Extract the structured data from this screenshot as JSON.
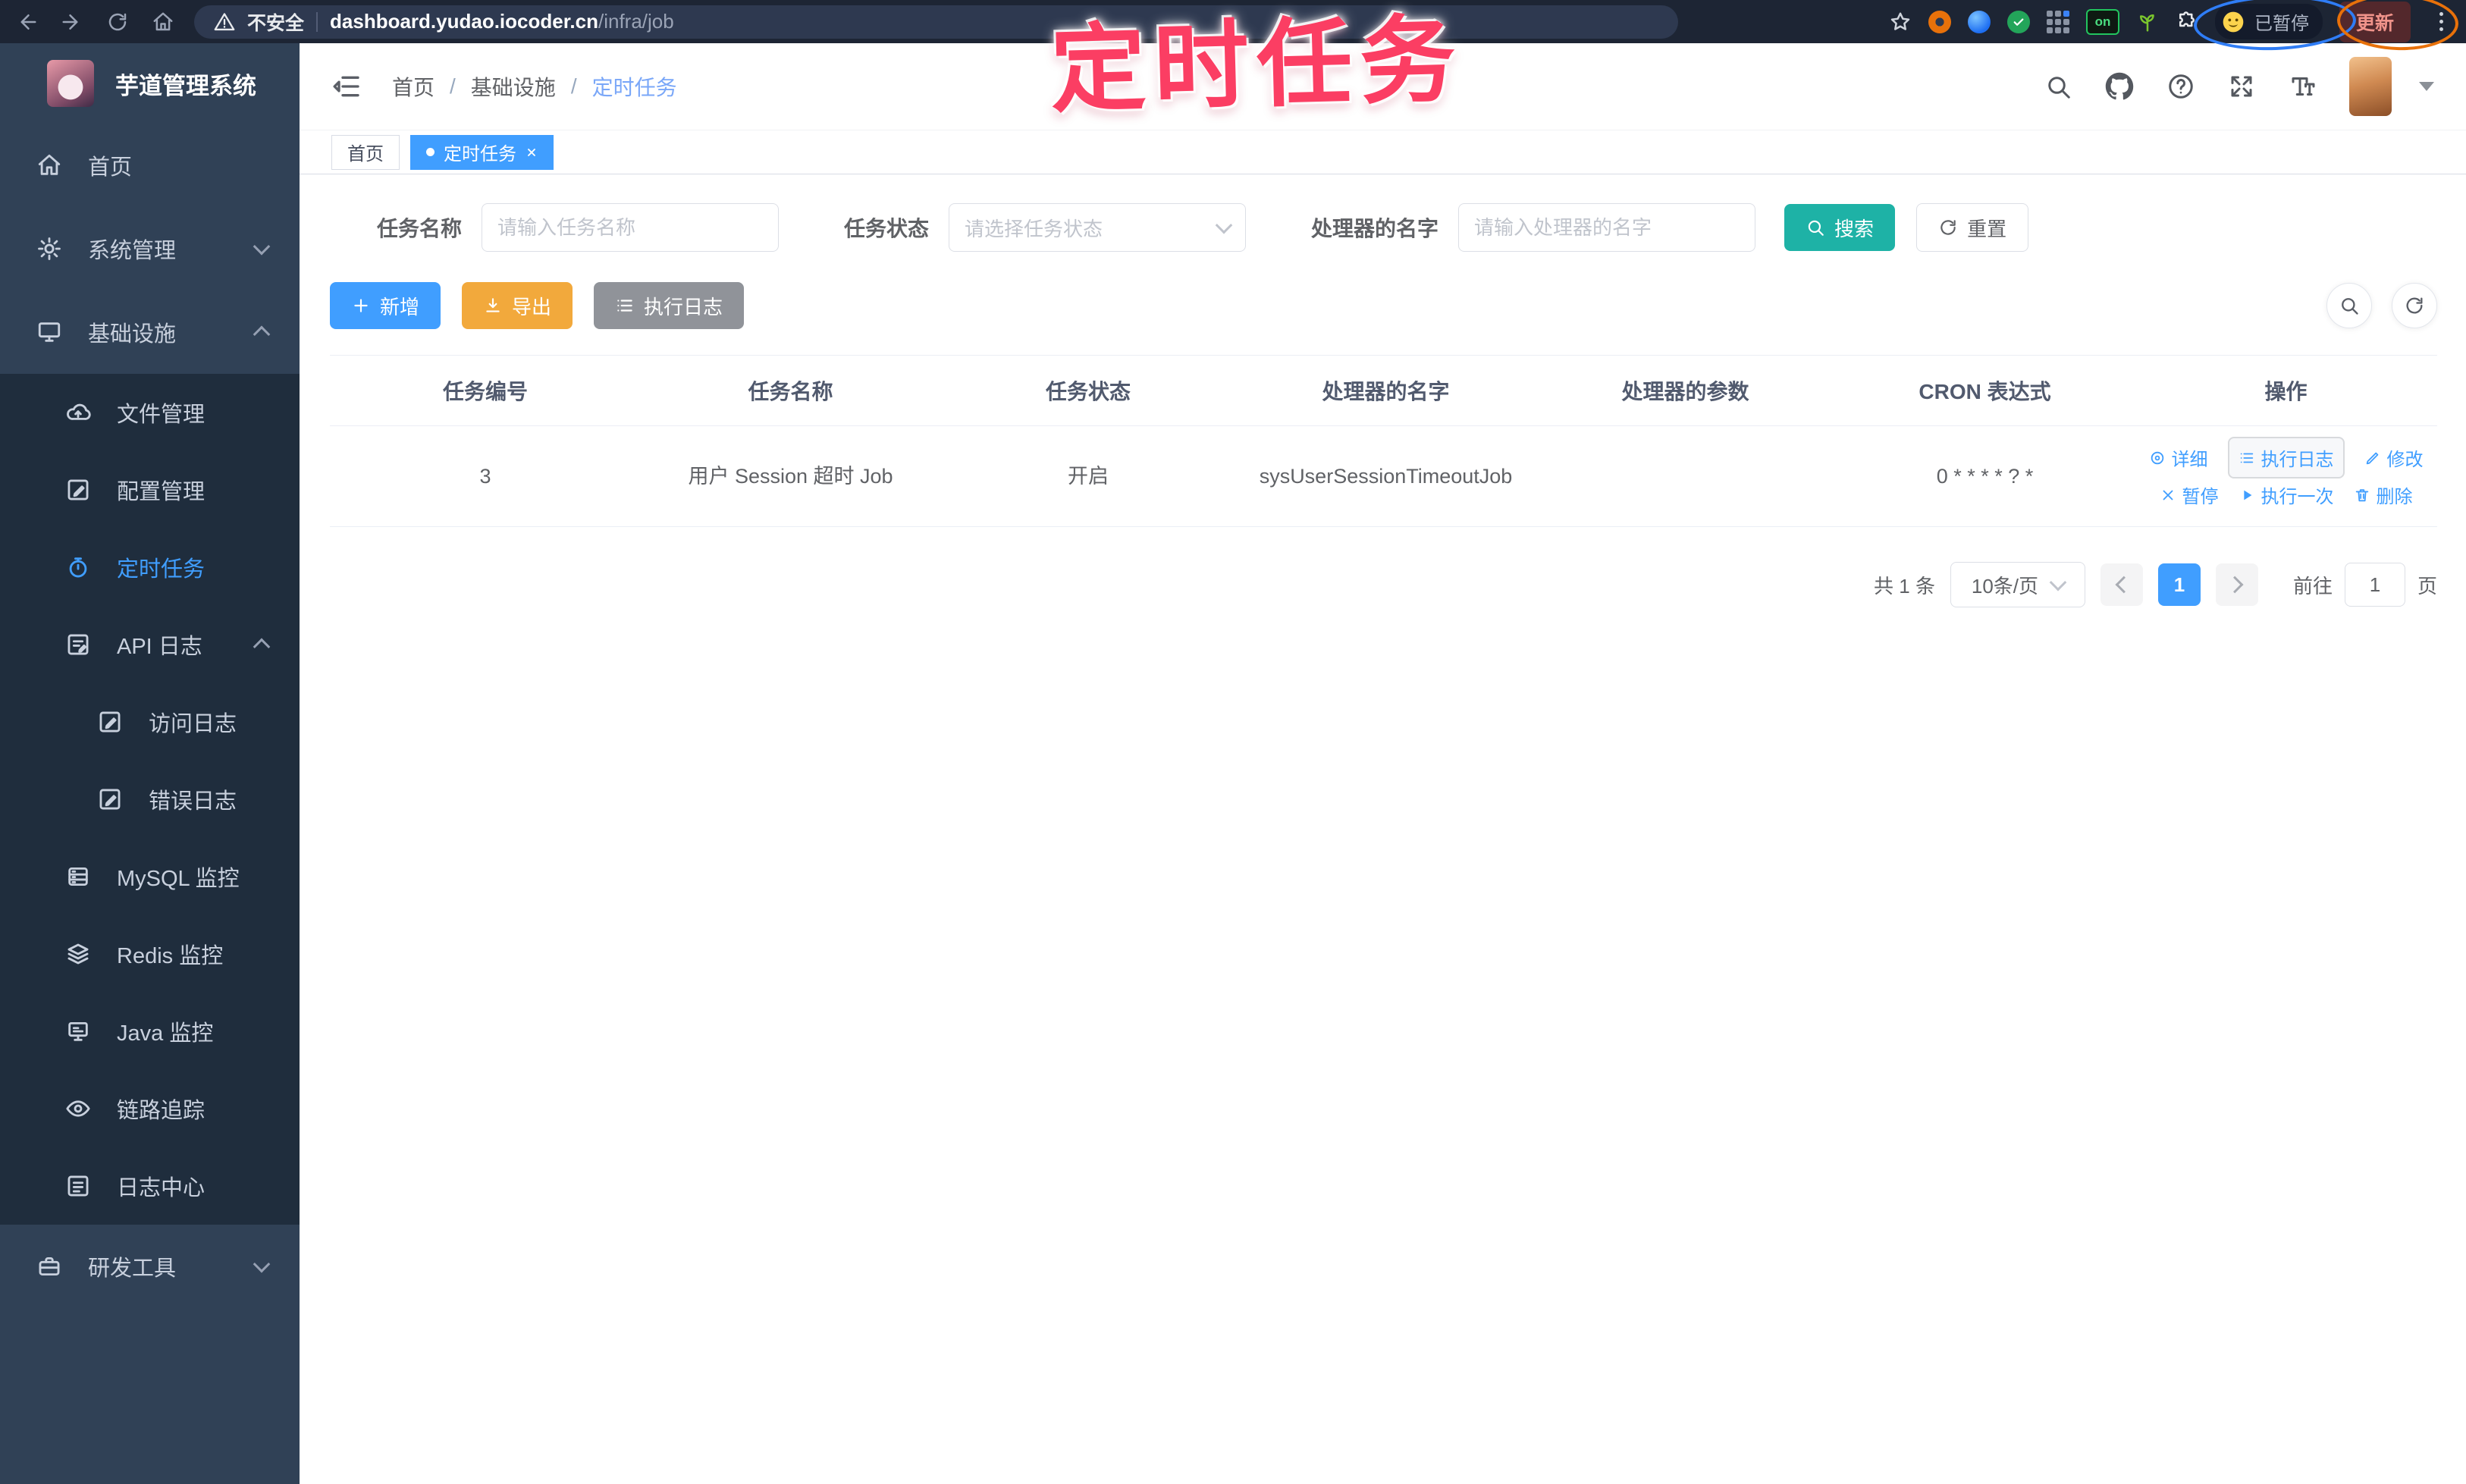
{
  "browser": {
    "security": "不安全",
    "url_domain": "dashboard.yudao.iocoder.cn",
    "url_path": "/infra/job",
    "on_badge": "on",
    "paused_label": "已暂停",
    "update_label": "更新"
  },
  "annotation": {
    "title": "定时任务"
  },
  "sidebar": {
    "logo_title": "芋道管理系统",
    "items": [
      "首页",
      "系统管理",
      "基础设施",
      "文件管理",
      "配置管理",
      "定时任务",
      "API 日志",
      "访问日志",
      "错误日志",
      "MySQL 监控",
      "Redis 监控",
      "Java 监控",
      "链路追踪",
      "日志中心",
      "研发工具"
    ]
  },
  "header": {
    "breadcrumb": [
      "首页",
      "基础设施",
      "定时任务"
    ],
    "separator": "/"
  },
  "tags": {
    "home": "首页",
    "active": "定时任务"
  },
  "filters": {
    "task_name_label": "任务名称",
    "task_name_placeholder": "请输入任务名称",
    "task_status_label": "任务状态",
    "task_status_placeholder": "请选择任务状态",
    "handler_label": "处理器的名字",
    "handler_placeholder": "请输入处理器的名字",
    "search": "搜索",
    "reset": "重置"
  },
  "toolbar": {
    "add": "新增",
    "export": "导出",
    "exec_log": "执行日志"
  },
  "table": {
    "headers": [
      "任务编号",
      "任务名称",
      "任务状态",
      "处理器的名字",
      "处理器的参数",
      "CRON 表达式",
      "操作"
    ],
    "row": {
      "id": "3",
      "name": "用户 Session 超时 Job",
      "status": "开启",
      "handler": "sysUserSessionTimeoutJob",
      "params": "",
      "cron": "0 * * * * ? *"
    },
    "ops": [
      "详细",
      "执行日志",
      "修改",
      "暂停",
      "执行一次",
      "删除"
    ]
  },
  "pagination": {
    "total": "共 1 条",
    "page_size": "10条/页",
    "page": "1",
    "goto": "前往",
    "goto_value": "1",
    "unit": "页"
  },
  "colors": {
    "accent": "#409eff",
    "search_teal": "#1eb2a6",
    "export_orange": "#f2a93c",
    "info_gray": "#909399",
    "sidebar_bg": "#304156",
    "submenu_bg": "#1f2d3d",
    "annotation_pink": "#fb3e63"
  }
}
